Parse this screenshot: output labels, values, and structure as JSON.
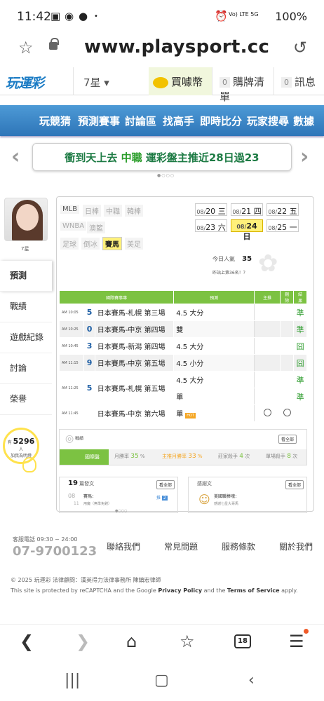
{
  "status": {
    "time": "11:42",
    "signal": "Vo) LTE 5G",
    "battery": "100%"
  },
  "browser": {
    "url": "www.playsport.cc",
    "tab_count": "18"
  },
  "header": {
    "logo": "玩運彩",
    "rank_select": "7星 ▾",
    "buy_coin": "買噱幣",
    "cart_count": "0",
    "cart": "購牌清單",
    "msg_count": "0",
    "msg": "訊息"
  },
  "nav": {
    "items": [
      "玩競猜",
      "預測賽事",
      "討論區",
      "找高手",
      "即時比分",
      "玩家搜尋",
      "數據"
    ]
  },
  "banner": {
    "text_pre": "衝到天上去 ",
    "text_hl": "中職",
    "text_post": " 運彩盤主推近28日過23"
  },
  "profile": {
    "name": "7星",
    "menu": [
      "預測",
      "戰績",
      "遊戲紀錄",
      "討論",
      "榮譽"
    ],
    "fans": "5296",
    "fans_pre": "有",
    "fans_suffix": "人",
    "fans_note": "加我為明燈"
  },
  "leagues": {
    "row1": [
      "MLB",
      "日棒",
      "中職",
      "韓棒"
    ],
    "row2": [
      "WNBA",
      "澳籃"
    ],
    "row3": [
      "足球",
      "倒冰",
      "賽馬",
      "美足"
    ]
  },
  "dates": [
    {
      "m": "08/",
      "d": "20",
      "w": "三"
    },
    {
      "m": "08/",
      "d": "21",
      "w": "四"
    },
    {
      "m": "08/",
      "d": "22",
      "w": "五"
    },
    {
      "m": "08/",
      "d": "23",
      "w": "六"
    },
    {
      "m": "08/",
      "d": "24",
      "w": "日"
    },
    {
      "m": "08/",
      "d": "25",
      "w": "一"
    }
  ],
  "popularity": {
    "label": "今日人氣",
    "value": "35",
    "rank": "昨站上第36名！？"
  },
  "table": {
    "headers": [
      "國際賽事專",
      "預測",
      "主推",
      "刪除",
      "結果"
    ],
    "rows": [
      {
        "time": "AM 10:05",
        "num": "5",
        "game": "日本賽馬-札幌 第三場",
        "pick": "4.5 大分",
        "result": "準"
      },
      {
        "time": "AM 10:25",
        "num": "0",
        "game": "日本賽馬-中京 第四場",
        "pick": "雙",
        "result": "準"
      },
      {
        "time": "AM 10:45",
        "num": "3",
        "game": "日本賽馬-新潟 第四場",
        "pick": "4.5 大分",
        "result": "囧"
      },
      {
        "time": "AM 11:15",
        "num": "9",
        "game": "日本賽馬-中京 第五場",
        "pick": "4.5 小分",
        "result": "囧"
      },
      {
        "time": "AM 11:25",
        "num": "5",
        "game": "日本賽馬-札幌 第五場",
        "pick": "4.5 大分",
        "result": "準"
      },
      {
        "time": "",
        "num": "",
        "game": "",
        "pick": "單",
        "result": "準"
      },
      {
        "time": "AM 11:45",
        "num": "",
        "game": "日本賽馬-中京 第六場",
        "pick": "單",
        "result": ""
      }
    ]
  },
  "stats": {
    "title": "戰績",
    "more": "看全部",
    "items": [
      "國際盤",
      "月勝率",
      "35",
      "%",
      "主推月勝率",
      "33",
      "%",
      "莊家殺手",
      "4",
      "次",
      "單場殺手",
      "8",
      "次"
    ]
  },
  "panels": {
    "left_count": "19",
    "left_title": "篇發文",
    "left_more": "看全部",
    "post_date_m": "08",
    "post_date_d": "11",
    "post_title": "賽馬：",
    "post_sub": "用魔（無準免錢）",
    "post_badge": "2",
    "right_title": "感謝文",
    "right_more": "看全部",
    "thanks_title": "美國職棒魂：",
    "thanks_sub": "感謝七星大哥馬"
  },
  "footer": {
    "hours": "客服電話 09:30 ~ 24:00",
    "phone": "07-9700123",
    "links": [
      "聯絡我們",
      "常見問題",
      "服務條款",
      "關於我們"
    ],
    "copyright": "© 2025 玩運彩 法律顧問：漢英得力法律事務所 陳鎮宏律師",
    "recaptcha_pre": "This site is protected by reCAPTCHA and the Google ",
    "privacy": "Privacy Policy",
    "and": " and the ",
    "terms": "Terms of Service",
    "apply": " apply."
  }
}
